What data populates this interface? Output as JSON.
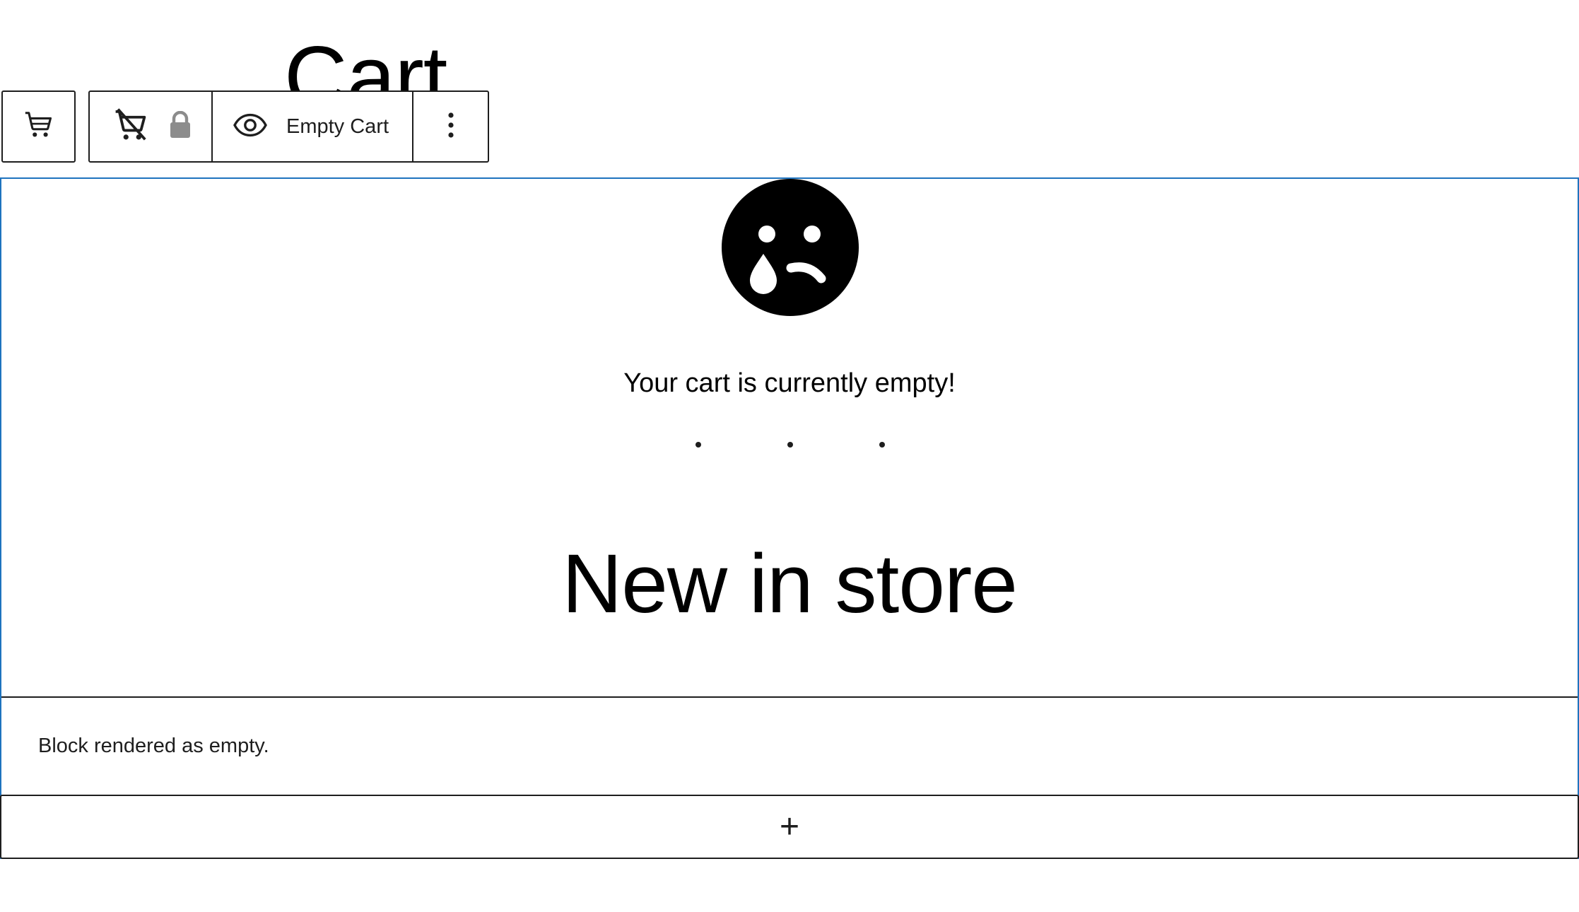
{
  "page": {
    "title": "Cart"
  },
  "toolbar": {
    "parent_icon": "cart-icon",
    "block_icon": "empty-cart-icon",
    "lock_icon": "lock-icon",
    "view_icon": "eye-icon",
    "view_label": "Empty Cart",
    "more_icon": "more-vertical-icon"
  },
  "empty_cart": {
    "face_icon": "sad-face-icon",
    "message": "Your cart is currently empty!",
    "heading": "New in store"
  },
  "notice": {
    "text": "Block rendered as empty."
  },
  "appender": {
    "label": "+"
  },
  "colors": {
    "selection_border": "#1e73be",
    "toolbar_border": "#1e1e1e",
    "lock_gray": "#8c8c8c"
  }
}
